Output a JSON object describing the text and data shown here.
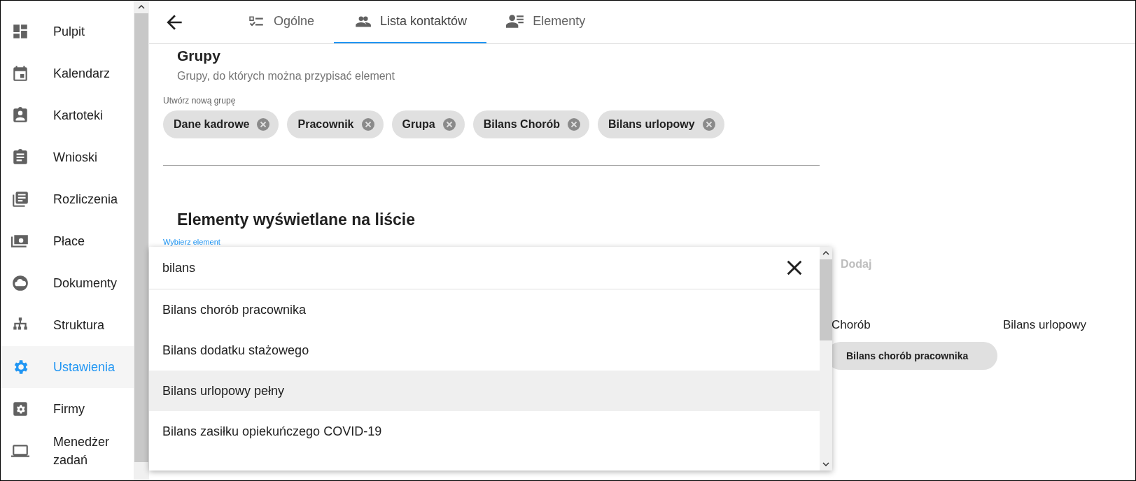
{
  "sidebar": {
    "items": [
      {
        "label": "Pulpit",
        "selected": false
      },
      {
        "label": "Kalendarz",
        "selected": false
      },
      {
        "label": "Kartoteki",
        "selected": false
      },
      {
        "label": "Wnioski",
        "selected": false
      },
      {
        "label": "Rozliczenia",
        "selected": false
      },
      {
        "label": "Płace",
        "selected": false
      },
      {
        "label": "Dokumenty",
        "selected": false
      },
      {
        "label": "Struktura",
        "selected": false
      },
      {
        "label": "Ustawienia",
        "selected": true
      },
      {
        "label": "Firmy",
        "selected": false
      },
      {
        "label": "Menedżer zadań",
        "selected": false
      }
    ]
  },
  "tabs": [
    {
      "label": "Ogólne",
      "selected": false
    },
    {
      "label": "Lista kontaktów",
      "selected": true
    },
    {
      "label": "Elementy",
      "selected": false
    }
  ],
  "groups": {
    "title": "Grupy",
    "subtitle": "Grupy, do których można przypisać element",
    "field_label": "Utwórz nową grupę",
    "chips": [
      "Dane kadrowe",
      "Pracownik",
      "Grupa",
      "Bilans Chorób",
      "Bilans urlopowy"
    ]
  },
  "elements": {
    "title": "Elementy wyświetlane na liście",
    "field_label": "Wybierz element",
    "add_button": {
      "label": "Dodaj",
      "disabled": true
    },
    "columns": [
      "Chorób",
      "Bilans urlopowy"
    ],
    "chips": [
      "Bilans chorób pracownika"
    ]
  },
  "dropdown": {
    "value": "bilans",
    "options": [
      {
        "label": "Bilans chorób pracownika",
        "selected": false
      },
      {
        "label": "Bilans dodatku stażowego",
        "selected": false
      },
      {
        "label": "Bilans urlopowy pełny",
        "selected": true
      },
      {
        "label": "Bilans zasiłku opiekuńczego COVID-19",
        "selected": false
      }
    ]
  }
}
